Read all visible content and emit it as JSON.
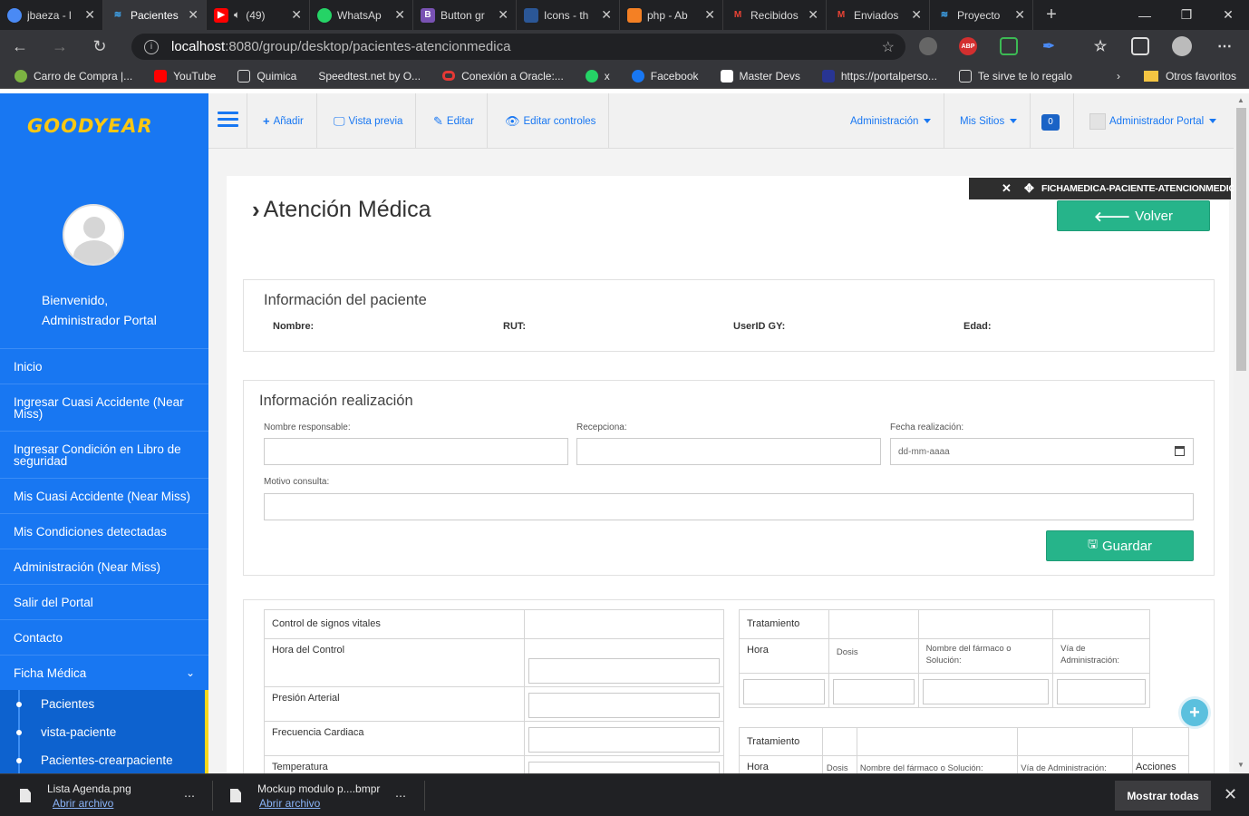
{
  "browser": {
    "tabs": [
      {
        "title": "jbaeza - l",
        "color": "#4a8af4"
      },
      {
        "title": "Pacientes",
        "color": "#3fa9f5"
      },
      {
        "title": "(49)",
        "color": "#ff0000"
      },
      {
        "title": "WhatsAp",
        "color": "#25d366"
      },
      {
        "title": "Button gr",
        "color": "#7952b3"
      },
      {
        "title": "Icons - th",
        "color": "#2b5797"
      },
      {
        "title": "php - Ab",
        "color": "#f48024"
      },
      {
        "title": "Recibidos",
        "color": "#ea4335"
      },
      {
        "title": "Enviados",
        "color": "#ea4335"
      },
      {
        "title": "Proyecto",
        "color": "#3fa9f5"
      }
    ],
    "url_host": "localhost",
    "url_rest": ":8080/group/desktop/pacientes-atencionmedica",
    "bookmarks": [
      "Carro de Compra |...",
      "YouTube",
      "Quimica",
      "Speedtest.net by O...",
      "Conexión a Oracle:...",
      "x",
      "Facebook",
      "Master Devs",
      "https://portalperso...",
      "Te sirve te lo regalo"
    ],
    "other_bookmarks": "Otros favoritos",
    "ext_abp": "ABP"
  },
  "sidebar": {
    "brand": "GOODYEAR",
    "welcome_1": "Bienvenido,",
    "welcome_2": "Administrador Portal",
    "menu": [
      "Inicio",
      "Ingresar Cuasi Accidente (Near Miss)",
      "Ingresar Condición en Libro de seguridad",
      "Mis Cuasi Accidente (Near Miss)",
      "Mis Condiciones detectadas",
      "Administración (Near Miss)",
      "Salir del Portal",
      "Contacto",
      "Ficha Médica"
    ],
    "submenu": [
      "Pacientes",
      "vista-paciente",
      "Pacientes-crearpaciente"
    ]
  },
  "topnav": {
    "add": "Añadir",
    "preview": "Vista previa",
    "edit": "Editar",
    "edit_controls": "Editar controles",
    "admin": "Administración",
    "sites": "Mis Sitios",
    "notifications": "0",
    "user": "Administrador Portal"
  },
  "portlet_tag": "FICHAMEDICA-PACIENTE-ATENCIONMEDICA",
  "page": {
    "title": "Atención Médica",
    "back_button": "Volver",
    "patient_info": {
      "title": "Información del paciente",
      "name_label": "Nombre:",
      "rut_label": "RUT:",
      "userid_label": "UserID GY:",
      "age_label": "Edad:"
    },
    "realization": {
      "title": "Información realización",
      "responsable_label": "Nombre responsable:",
      "recepciona_label": "Recepciona:",
      "fecha_label": "Fecha realización:",
      "fecha_placeholder": "dd-mm-aaaa",
      "motivo_label": "Motivo consulta:",
      "save_button": "Guardar"
    },
    "vitals": {
      "header": "Control de signos vitales",
      "rows": [
        "Hora del Control",
        "Presión Arterial",
        "Frecuencia Cardiaca",
        "Temperatura"
      ]
    },
    "treatment1": {
      "header": "Tratamiento",
      "cols": [
        "Hora",
        "Dosis",
        "Nombre del fármaco o Solución:",
        "Vía de Administración:"
      ]
    },
    "treatment2": {
      "header": "Tratamiento",
      "cols": [
        "Hora",
        "Dosis",
        "Nombre del fármaco o Solución:",
        "Vía de Administración:",
        "Acciones"
      ]
    }
  },
  "downloads": [
    {
      "name": "Lista Agenda.png",
      "action": "Abrir archivo"
    },
    {
      "name": "Mockup modulo p....bmpr",
      "action": "Abrir archivo"
    }
  ],
  "show_all": "Mostrar todas"
}
